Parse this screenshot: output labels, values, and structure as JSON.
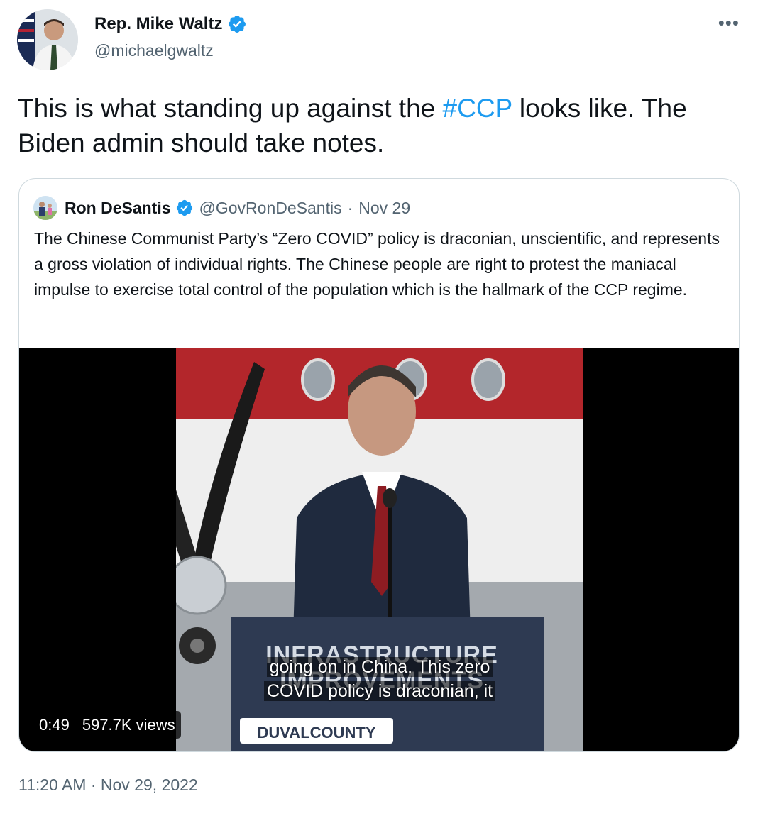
{
  "author": {
    "name": "Rep. Mike Waltz",
    "handle": "@michaelgwaltz"
  },
  "menu": {
    "more_icon": "more-horizontal-icon"
  },
  "tweet": {
    "text_before": "This is what standing up against the ",
    "hashtag": "#CCP",
    "text_after": " looks like. The Biden admin should take notes."
  },
  "quoted": {
    "name": "Ron DeSantis",
    "handle": "@GovRonDeSantis",
    "separator": "·",
    "date": "Nov 29",
    "text": "The Chinese Communist Party’s “Zero COVID” policy is draconian, unscientific, and represents a gross violation of individual rights. The Chinese people are right to protest the maniacal impulse to exercise total control of the population which is the hallmark of the CCP regime."
  },
  "video": {
    "podium_line1": "INFRASTRUCTURE",
    "podium_line2": "IMPROVEMENTS",
    "podium_logo": "DUVALCOUNTY",
    "caption_line1": "going on in China. This zero",
    "caption_line2": "COVID policy is draconian, it",
    "duration": "0:49",
    "views": "597.7K views"
  },
  "timestamp": "11:20 AM · Nov 29, 2022",
  "colors": {
    "link": "#1d9bf0",
    "verified": "#1d9bf0",
    "muted": "#536471"
  }
}
